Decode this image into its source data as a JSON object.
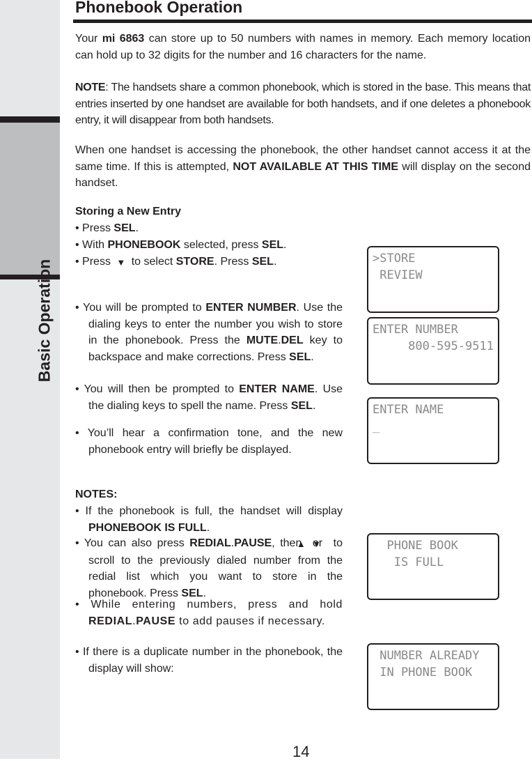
{
  "sidebar": {
    "tab_label": "Basic Operation"
  },
  "header": {
    "title": "Phonebook Operation"
  },
  "paragraphs": [
    [
      {
        "t": "Your "
      },
      {
        "t": "mi 6863",
        "b": true
      },
      {
        "t": " can store up to 50 numbers with names in memory. Each memory location can hold up to 32 digits for the number and 16 characters for the name."
      }
    ],
    [
      {
        "t": "NOTE",
        "b": true
      },
      {
        "t": ": The handsets share a common phonebook, which is stored in the base.  This means that entries inserted by one handset are available for both handsets, and if one deletes a phonebook entry, it will disappear from both handsets."
      }
    ],
    [
      {
        "t": "When one handset is accessing the phonebook, the other handset cannot access it at the same time. If this is attempted, "
      },
      {
        "t": "NOT AVAILABLE AT THIS TIME",
        "b": true
      },
      {
        "t": " will display on the second handset."
      }
    ]
  ],
  "storing": {
    "heading": "Storing a New Entry",
    "steps": [
      [
        {
          "t": "•  Press "
        },
        {
          "t": "SEL",
          "b": true
        },
        {
          "t": "."
        }
      ],
      [
        {
          "t": "•  With "
        },
        {
          "t": "PHONEBOOK",
          "b": true
        },
        {
          "t": " selected, press "
        },
        {
          "t": "SEL",
          "b": true
        },
        {
          "t": "."
        }
      ],
      [
        {
          "t": "•  Press "
        },
        {
          "icon": "down-arrow-icon"
        },
        {
          "t": " to select "
        },
        {
          "t": "STORE",
          "b": true
        },
        {
          "t": ". Press "
        },
        {
          "t": "SEL",
          "b": true
        },
        {
          "t": "."
        }
      ]
    ],
    "details": [
      [
        {
          "t": "•   You will be prompted to "
        },
        {
          "t": "ENTER NUMBER",
          "b": true
        },
        {
          "t": ". Use the dialing keys to enter the number you wish to store in the phonebook. Press the "
        },
        {
          "t": "MUTE",
          "b": true
        },
        {
          "t": "."
        },
        {
          "t": "DEL",
          "b": true
        },
        {
          "t": " key to backspace and make corrections. Press "
        },
        {
          "t": "SEL",
          "b": true
        },
        {
          "t": "."
        }
      ],
      [
        {
          "t": "•   You will then be prompted to "
        },
        {
          "t": "ENTER NAME",
          "b": true
        },
        {
          "t": ". Use the dialing keys to spell the name. Press "
        },
        {
          "t": "SEL",
          "b": true
        },
        {
          "t": "."
        }
      ],
      [
        {
          "t": "•    You’ll hear a confirmation tone, and the new phonebook entry will briefly be displayed."
        }
      ]
    ]
  },
  "notes": {
    "heading": "NOTES:",
    "items": [
      [
        {
          "t": "•    If the phonebook is full, the handset will display "
        },
        {
          "t": "PHONEBOOK IS FULL",
          "b": true
        },
        {
          "t": "."
        }
      ],
      [
        {
          "t": "•    You can also press "
        },
        {
          "t": "REDIAL",
          "b": true
        },
        {
          "t": "."
        },
        {
          "t": "PAUSE",
          "b": true
        },
        {
          "t": ", then "
        },
        {
          "icon": "up-arrow-icon"
        },
        {
          "t": "or"
        },
        {
          "icon": "down-arrow-icon"
        },
        {
          "t": " to scroll to the previously dialed number from the redial list which you want to store in the phonebook. Press "
        },
        {
          "t": "SEL",
          "b": true
        },
        {
          "t": "."
        }
      ],
      [
        {
          "t": "•   While entering numbers, press and hold "
        },
        {
          "t": "REDIAL",
          "b": true
        },
        {
          "t": "."
        },
        {
          "t": "PAUSE",
          "b": true
        },
        {
          "t": " to add pauses if necessary."
        }
      ],
      [
        {
          "t": "•   If there is a duplicate number in the phonebook, the display will show:"
        }
      ]
    ]
  },
  "displays": {
    "store_menu": ">STORE\n REVIEW",
    "enter_number": "ENTER NUMBER\n     800-595-9511",
    "enter_name": "ENTER NAME\n_",
    "phonebook_full": "  PHONE BOOK\n   IS FULL",
    "number_already": " NUMBER ALREADY\n IN PHONE BOOK"
  },
  "page_number": "14"
}
